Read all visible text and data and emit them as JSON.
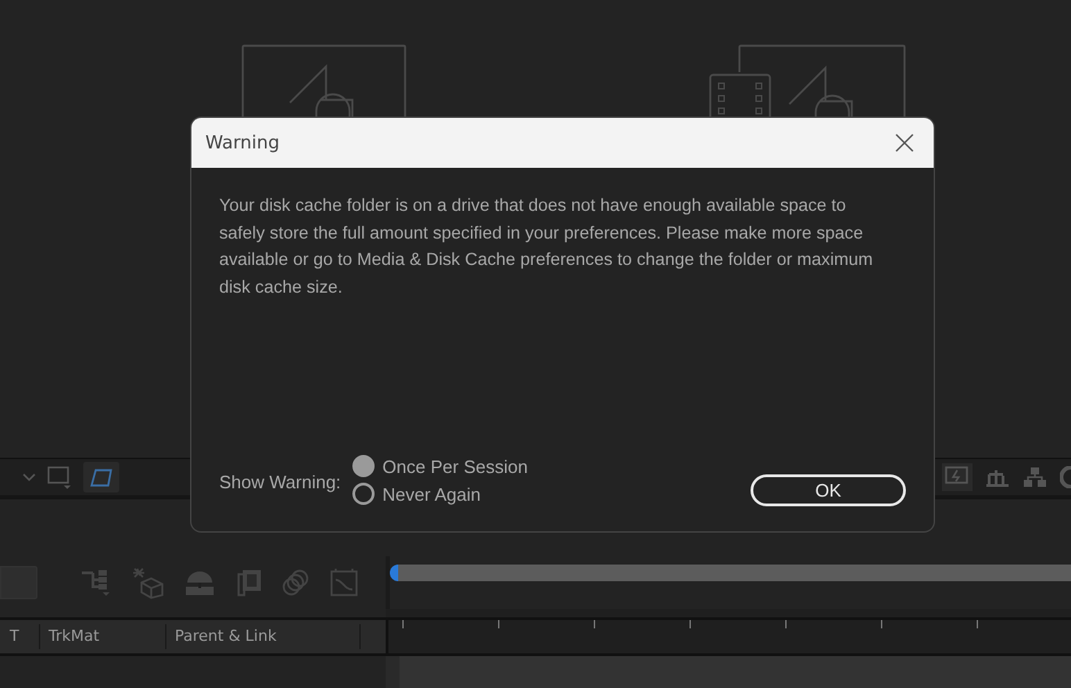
{
  "timeline": {
    "columns": [
      {
        "label": "T"
      },
      {
        "label": "TrkMat"
      },
      {
        "label": "Parent & Link"
      }
    ]
  },
  "dialog": {
    "title": "Warning",
    "message": "Your disk cache folder is on a drive that does not have enough available space to safely store the full amount specified in your preferences. Please make more space available or go to Media & Disk Cache preferences to change the folder or maximum disk cache size.",
    "show_warning_label": "Show Warning:",
    "options": [
      {
        "label": "Once Per Session",
        "selected": true
      },
      {
        "label": "Never Again",
        "selected": false
      }
    ],
    "ok_button": "OK"
  }
}
